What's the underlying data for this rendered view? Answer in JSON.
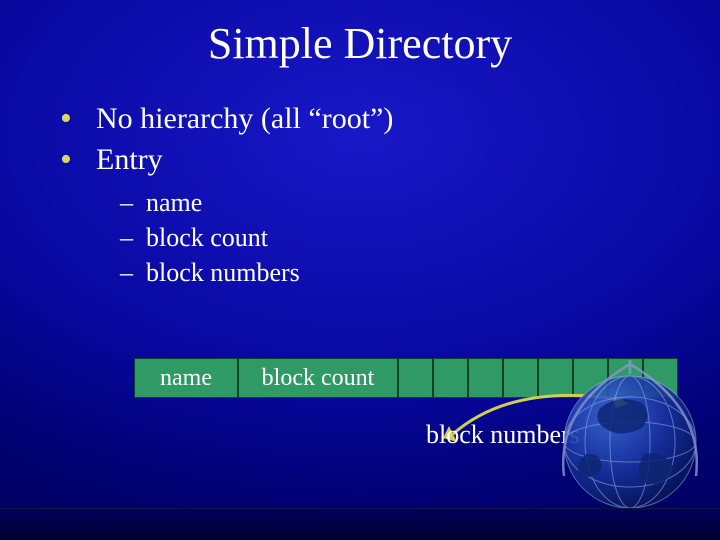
{
  "title": "Simple Directory",
  "bullets": [
    "No hierarchy (all “root”)",
    "Entry"
  ],
  "sub_bullets": [
    "name",
    "block count",
    "block numbers"
  ],
  "diagram": {
    "name_label": "name",
    "block_count_label": "block count",
    "block_numbers_label": "block numbers",
    "small_cell_count": 8
  }
}
